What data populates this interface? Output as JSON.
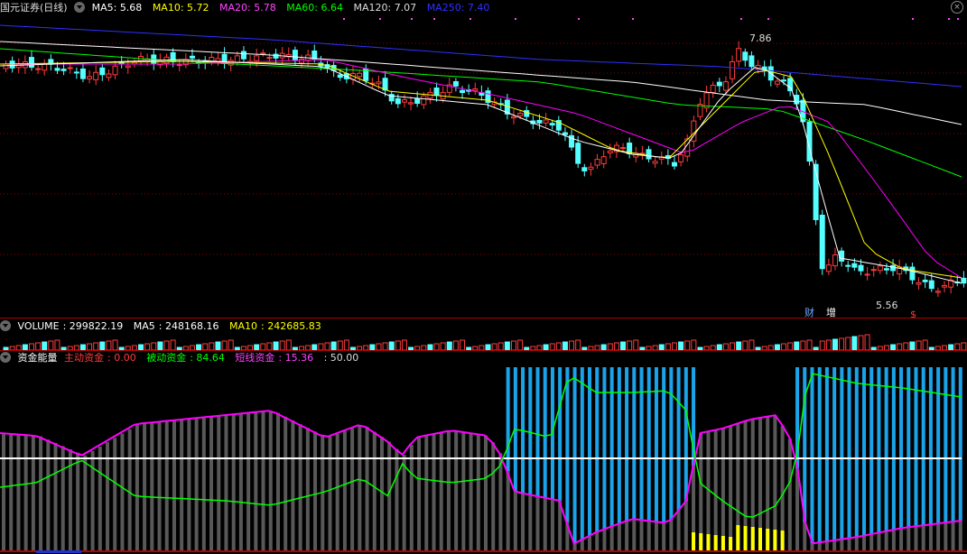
{
  "colors": {
    "up": "#ff3b3b",
    "down": "#54ffff",
    "ma5": "#ffffff",
    "ma10": "#ffff00",
    "ma20": "#ff00ff",
    "ma60": "#00ff00",
    "ma120": "#ffffff",
    "ma250": "#3030ff",
    "volume_ma10": "#ffff00"
  },
  "price_panel": {
    "title": "国元证券(日线)",
    "indicators": [
      {
        "name": "MA5",
        "value": "5.68"
      },
      {
        "name": "MA10",
        "value": "5.72"
      },
      {
        "name": "MA20",
        "value": "5.78"
      },
      {
        "name": "MA60",
        "value": "6.64"
      },
      {
        "name": "MA120",
        "value": "7.07"
      },
      {
        "name": "MA250",
        "value": "7.40"
      }
    ],
    "high_label": "7.86",
    "low_label": "5.56",
    "markers": [
      "财",
      "增",
      "$"
    ]
  },
  "volume_panel": {
    "title": "VOLUME",
    "value": "299822.19",
    "ma5_label": "MA5",
    "ma5": "248168.16",
    "ma10_label": "MA10",
    "ma10": "242685.83"
  },
  "fund_panel": {
    "title": "资金能量",
    "active_label": "主动资金",
    "active": "0.00",
    "passive_label": "被动资金",
    "passive": "84.64",
    "short_label": "短线资金",
    "short": "15.36",
    "extra": ": 50.00"
  }
}
